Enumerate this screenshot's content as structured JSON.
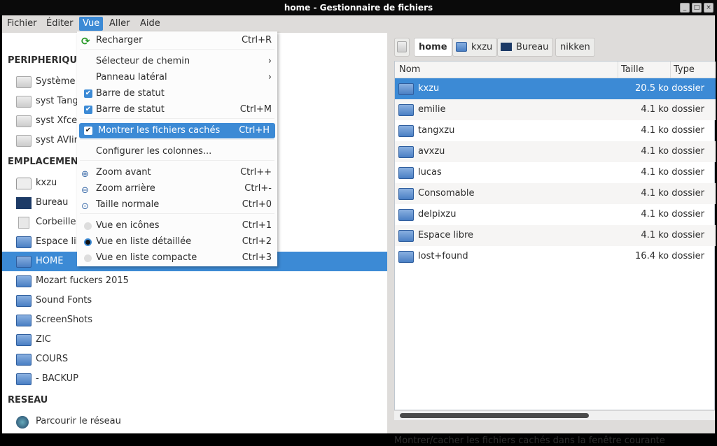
{
  "window": {
    "title": "home - Gestionnaire de fichiers",
    "controls": [
      "_",
      "□",
      "×"
    ]
  },
  "menubar": [
    "Fichier",
    "Éditer",
    "Vue",
    "Aller",
    "Aide"
  ],
  "sidebar": {
    "sections": [
      {
        "title": "PERIPHERIQUES",
        "items": [
          "Système",
          "syst Tang",
          "syst Xfce",
          "syst AVlinux"
        ]
      },
      {
        "title": "EMPLACEMENTS",
        "items": [
          "kxzu",
          "Bureau",
          "Corbeille",
          "Espace libre",
          "HOME",
          "Mozart fuckers 2015",
          "Sound Fonts",
          "ScreenShots",
          "ZIC",
          "COURS",
          " - BACKUP"
        ]
      },
      {
        "title": "RESEAU",
        "items": [
          "Parcourir le réseau"
        ]
      }
    ],
    "selected": "HOME"
  },
  "breadcrumb": [
    "home",
    "kxzu",
    "Bureau",
    "nikken"
  ],
  "columns": {
    "name": "Nom",
    "size": "Taille",
    "type": "Type"
  },
  "files": [
    {
      "name": "kxzu",
      "size": "20.5 ko",
      "type": "dossier",
      "selected": true
    },
    {
      "name": "emilie",
      "size": "4.1 ko",
      "type": "dossier"
    },
    {
      "name": "tangxzu",
      "size": "4.1 ko",
      "type": "dossier"
    },
    {
      "name": "avxzu",
      "size": "4.1 ko",
      "type": "dossier"
    },
    {
      "name": "lucas",
      "size": "4.1 ko",
      "type": "dossier"
    },
    {
      "name": "Consomable",
      "size": "4.1 ko",
      "type": "dossier"
    },
    {
      "name": "delpixzu",
      "size": "4.1 ko",
      "type": "dossier"
    },
    {
      "name": "Espace libre",
      "size": "4.1 ko",
      "type": "dossier"
    },
    {
      "name": "lost+found",
      "size": "16.4 ko",
      "type": "dossier"
    }
  ],
  "status": "Montrer/cacher les fichiers cachés dans la fenêtre courante",
  "view_menu": [
    {
      "label": "Recharger",
      "shortcut": "Ctrl+R",
      "icon": "reload"
    },
    {
      "label": "Sélecteur de chemin",
      "shortcut": "›",
      "submenu": true
    },
    {
      "label": "Panneau latéral",
      "shortcut": "›",
      "submenu": true
    },
    {
      "label": "Barre de statut",
      "check": true
    },
    {
      "label": "Barre de statut",
      "shortcut": "Ctrl+M",
      "check": true
    },
    {
      "label": "Montrer les fichiers cachés",
      "shortcut": "Ctrl+H",
      "check": true,
      "highlighted": true
    },
    {
      "label": "Configurer les colonnes..."
    },
    {
      "label": "Zoom avant",
      "shortcut": "Ctrl++",
      "icon": "zoom-in"
    },
    {
      "label": "Zoom arrière",
      "shortcut": "Ctrl+-",
      "icon": "zoom-out"
    },
    {
      "label": "Taille normale",
      "shortcut": "Ctrl+0",
      "icon": "zoom-normal"
    },
    {
      "label": "Vue en icônes",
      "shortcut": "Ctrl+1",
      "radio": false
    },
    {
      "label": "Vue en liste détaillée",
      "shortcut": "Ctrl+2",
      "radio": true
    },
    {
      "label": "Vue en liste compacte",
      "shortcut": "Ctrl+3",
      "radio": false
    }
  ],
  "colors": {
    "accent": "#3c8ad5",
    "titlebar": "#0a0a0a",
    "window": "#dedcda"
  }
}
